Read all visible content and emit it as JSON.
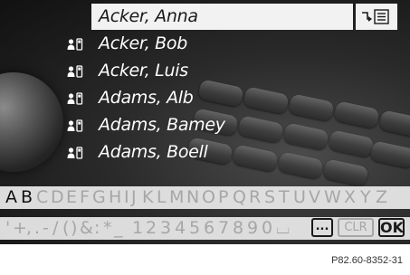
{
  "contacts": [
    {
      "name": "Acker, Anna",
      "selected": true
    },
    {
      "name": "Acker, Bob",
      "selected": false
    },
    {
      "name": "Acker, Luis",
      "selected": false
    },
    {
      "name": "Adams, Alb",
      "selected": false
    },
    {
      "name": "Adams, Bamey",
      "selected": false
    },
    {
      "name": "Adams, Boell",
      "selected": false
    }
  ],
  "menu_button": {
    "icon": "list-menu-icon"
  },
  "letters": {
    "chars": [
      "A",
      "B",
      "C",
      "D",
      "E",
      "F",
      "G",
      "H",
      "I",
      "J",
      "K",
      "L",
      "M",
      "N",
      "O",
      "P",
      "Q",
      "R",
      "S",
      "T",
      "U",
      "V",
      "W",
      "X",
      "Y",
      "Z"
    ],
    "active": [
      "A",
      "B"
    ]
  },
  "symbols": {
    "chars": [
      "'",
      "+",
      ",",
      ".",
      "-",
      "/",
      "(",
      ")",
      "&",
      ":",
      "*",
      "_",
      "1",
      "2",
      "3",
      "4",
      "5",
      "6",
      "7",
      "8",
      "9",
      "0",
      "⌴"
    ],
    "more_label": "...",
    "clear_label": "CLR",
    "ok_label": "OK"
  },
  "caption": "P82.60-8352-31",
  "colors": {
    "selected_row": "#f2f2f2",
    "bar_bg": "#ebebeb",
    "inactive_char": "#a6a6a6",
    "active_char": "#111111"
  }
}
